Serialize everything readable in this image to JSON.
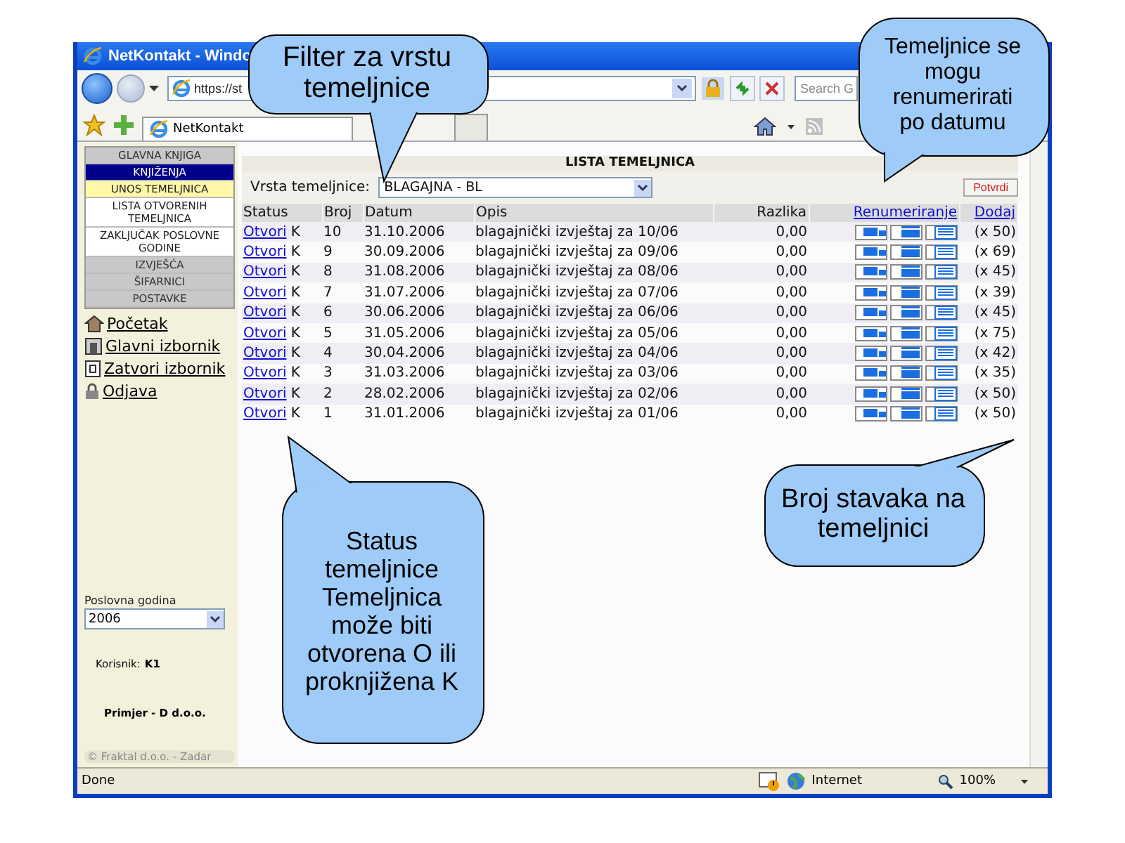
{
  "window": {
    "title": "NetKontakt - Windo"
  },
  "toolbar": {
    "address": "https://st",
    "search_placeholder": "Search G"
  },
  "tabs": [
    {
      "label": "NetKontakt",
      "selected": true
    }
  ],
  "sidebar": {
    "items": [
      {
        "label": "GLAVNA KNJIGA",
        "kind": "section",
        "selected": false
      },
      {
        "label": "KNJIŽENJA",
        "kind": "section",
        "selected": true
      },
      {
        "label": "UNOS TEMELJNICA",
        "kind": "subitem",
        "selected": true
      },
      {
        "label": "LISTA OTVORENIH TEMELJNICA",
        "kind": "subitem",
        "selected": false
      },
      {
        "label": "ZAKLJUČAK POSLOVNE GODINE",
        "kind": "subitem",
        "selected": false
      },
      {
        "label": "IZVJEŠĆA",
        "kind": "section",
        "selected": false
      },
      {
        "label": "ŠIFARNICI",
        "kind": "section",
        "selected": false
      },
      {
        "label": "POSTAVKE",
        "kind": "section",
        "selected": false
      }
    ],
    "links": [
      {
        "label": "Početak",
        "kind": "home"
      },
      {
        "label": "Glavni izbornik",
        "kind": "menu"
      },
      {
        "label": "Zatvori izbornik",
        "kind": "close"
      },
      {
        "label": "Odjava",
        "kind": "lock"
      }
    ],
    "year_label": "Poslovna godina",
    "year_value": "2006",
    "user_label": "Korisnik:",
    "user_value": "K1",
    "company": "Primjer - D d.o.o.",
    "copyright": "© Fraktal d.o.o. - Zadar"
  },
  "main": {
    "title": "LISTA TEMELJNICA",
    "filter_label": "Vrsta temeljnice:",
    "filter_value": "BLAGAJNA - BL",
    "confirm": "Potvrdi",
    "columns": [
      "Status",
      "Broj",
      "Datum",
      "Opis",
      "Razlika",
      "Renumeriranje",
      "Dodaj"
    ],
    "rows": [
      {
        "link": "Otvori",
        "status": "K",
        "number": "10",
        "date": "31.10.2006",
        "description": "blagajnički izvještaj za 10/06",
        "difference": "0,00",
        "count": "(x 50)"
      },
      {
        "link": "Otvori",
        "status": "K",
        "number": "9",
        "date": "30.09.2006",
        "description": "blagajnički izvještaj za 09/06",
        "difference": "0,00",
        "count": "(x 69)"
      },
      {
        "link": "Otvori",
        "status": "K",
        "number": "8",
        "date": "31.08.2006",
        "description": "blagajnički izvještaj za 08/06",
        "difference": "0,00",
        "count": "(x 45)"
      },
      {
        "link": "Otvori",
        "status": "K",
        "number": "7",
        "date": "31.07.2006",
        "description": "blagajnički izvještaj za 07/06",
        "difference": "0,00",
        "count": "(x 39)"
      },
      {
        "link": "Otvori",
        "status": "K",
        "number": "6",
        "date": "30.06.2006",
        "description": "blagajnički izvještaj za 06/06",
        "difference": "0,00",
        "count": "(x 45)"
      },
      {
        "link": "Otvori",
        "status": "K",
        "number": "5",
        "date": "31.05.2006",
        "description": "blagajnički izvještaj za 05/06",
        "difference": "0,00",
        "count": "(x 75)"
      },
      {
        "link": "Otvori",
        "status": "K",
        "number": "4",
        "date": "30.04.2006",
        "description": "blagajnički izvještaj za 04/06",
        "difference": "0,00",
        "count": "(x 42)"
      },
      {
        "link": "Otvori",
        "status": "K",
        "number": "3",
        "date": "31.03.2006",
        "description": "blagajnički izvještaj za 03/06",
        "difference": "0,00",
        "count": "(x 35)"
      },
      {
        "link": "Otvori",
        "status": "K",
        "number": "2",
        "date": "28.02.2006",
        "description": "blagajnički izvještaj za 02/06",
        "difference": "0,00",
        "count": "(x 50)"
      },
      {
        "link": "Otvori",
        "status": "K",
        "number": "1",
        "date": "31.01.2006",
        "description": "blagajnički izvještaj za 01/06",
        "difference": "0,00",
        "count": "(x 50)"
      }
    ]
  },
  "status_bar": {
    "text": "Done",
    "zone": "Internet",
    "zoom": "100%"
  },
  "callouts": [
    {
      "text": "Filter za vrstu temeljnice"
    },
    {
      "text": "Temeljnice se mogu renumerirati po datumu"
    },
    {
      "text": "Broj stavaka na temeljnici"
    },
    {
      "text": "Status temeljnice Temeljnica može biti otvorena O ili proknjižena K"
    }
  ]
}
